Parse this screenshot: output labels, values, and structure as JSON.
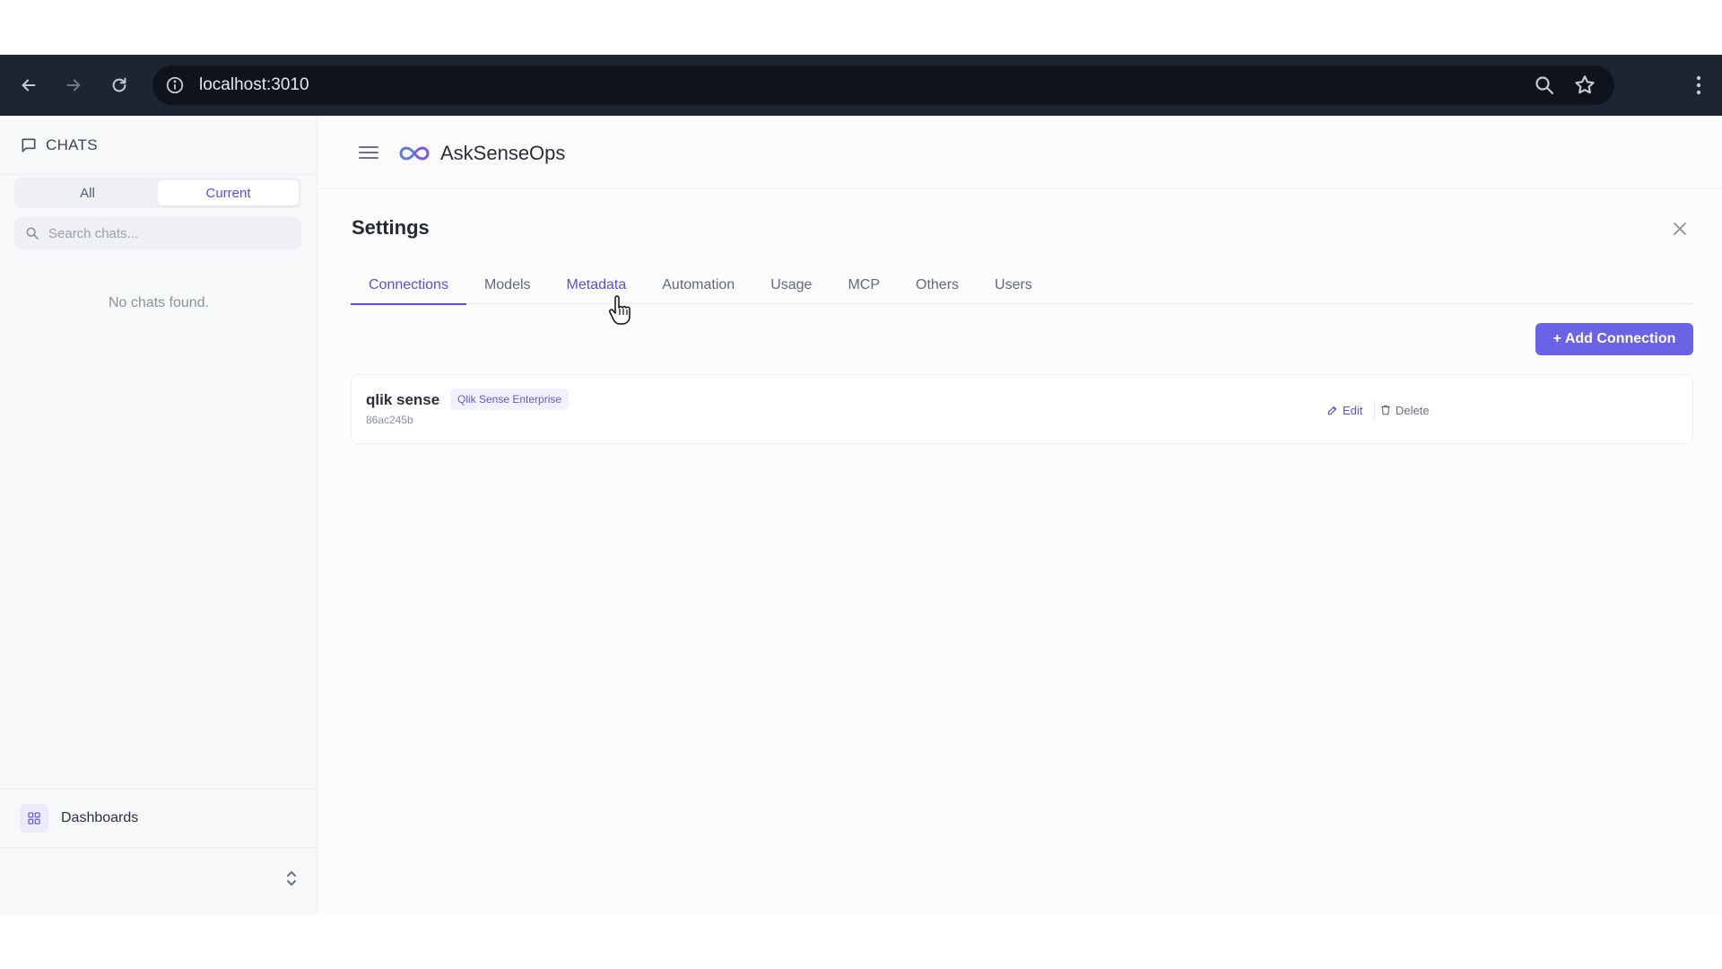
{
  "browser": {
    "url": "localhost:3010",
    "icons": [
      "back-arrow-icon",
      "forward-arrow-icon",
      "reload-icon",
      "site-info-icon",
      "zoom-icon",
      "bookmark-star-icon",
      "kebab-menu-icon"
    ]
  },
  "sidebar": {
    "title": "CHATS",
    "filter_tabs": [
      {
        "label": "All",
        "active": false
      },
      {
        "label": "Current",
        "active": true
      }
    ],
    "search_placeholder": "Search chats...",
    "empty_message": "No chats found.",
    "footer_item": {
      "label": "Dashboards",
      "icon": "grid-icon"
    }
  },
  "header": {
    "app_title": "AskSenseOps",
    "logo": "infinity-logo-icon"
  },
  "settings": {
    "title": "Settings",
    "tabs": [
      {
        "label": "Connections",
        "active": true
      },
      {
        "label": "Models",
        "active": false
      },
      {
        "label": "Metadata",
        "active": false,
        "hovered": true
      },
      {
        "label": "Automation",
        "active": false
      },
      {
        "label": "Usage",
        "active": false
      },
      {
        "label": "MCP",
        "active": false
      },
      {
        "label": "Others",
        "active": false
      },
      {
        "label": "Users",
        "active": false
      }
    ],
    "add_button_label": "+ Add Connection",
    "connections": [
      {
        "name": "qlik sense",
        "type_badge": "Qlik Sense Enterprise",
        "id": "86ac245b",
        "edit_label": "Edit",
        "delete_label": "Delete"
      }
    ]
  },
  "colors": {
    "accent": "#5b4fd8",
    "button": "#6b63e6",
    "browser_bar": "#1e2532"
  }
}
